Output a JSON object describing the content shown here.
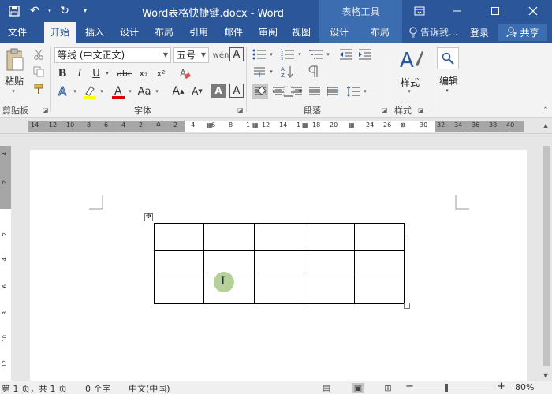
{
  "titlebar": {
    "title": "Word表格快捷键.docx - Word",
    "context_tools": "表格工具",
    "save_icon": "💾",
    "undo_icon": "↶",
    "redo_icon": "↻",
    "qat_more_icon": "⯆",
    "ribbon_options_icon": "▭",
    "minimize_icon": "—",
    "maximize_icon": "☐",
    "close_icon": "✕"
  },
  "tabs": [
    {
      "label": "文件"
    },
    {
      "label": "开始"
    },
    {
      "label": "插入"
    },
    {
      "label": "设计"
    },
    {
      "label": "布局"
    },
    {
      "label": "引用"
    },
    {
      "label": "邮件"
    },
    {
      "label": "审阅"
    },
    {
      "label": "视图"
    },
    {
      "label": "设计"
    },
    {
      "label": "布局"
    }
  ],
  "tell_me": "告诉我...",
  "login": "登录",
  "share": "共享",
  "ribbon": {
    "clipboard": {
      "label": "剪贴板",
      "paste_label": "粘贴"
    },
    "font": {
      "label": "字体",
      "font_name": "等线 (中文正文)",
      "font_size": "五号",
      "bold": "B",
      "italic": "I",
      "underline": "U",
      "strike": "abc",
      "subscript": "x₂",
      "superscript": "x²",
      "text_effects": "A",
      "highlight": "ab",
      "font_color": "A",
      "change_case": "Aa",
      "grow": "A",
      "shrink": "A",
      "clear_format": "A",
      "char_border": "A",
      "char_shade": "A",
      "phonetic": "wén",
      "enclose": "A"
    },
    "paragraph": {
      "label": "段落"
    },
    "styles": {
      "label": "样式",
      "button_label": "样式"
    },
    "editing": {
      "button_label": "编辑"
    }
  },
  "ruler": {
    "left_numbers": [
      "14",
      "12",
      "10",
      "8",
      "6",
      "4",
      "2"
    ],
    "mid_numbers": [
      "2",
      "4",
      "6",
      "8",
      "1",
      "12",
      "14",
      "1",
      "18",
      "20",
      "24",
      "26"
    ],
    "right_numbers": [
      "30",
      "32",
      "34",
      "36",
      "38",
      "40"
    ]
  },
  "vruler": {
    "numbers": [
      "4",
      "2",
      "2",
      "4",
      "6",
      "8",
      "10",
      "12"
    ]
  },
  "statusbar": {
    "pages": "第 1 页，共 1 页",
    "words": "0 个字",
    "language": "中文(中国)",
    "zoom": "80%",
    "zoom_minus": "−",
    "zoom_plus": "+"
  },
  "table": {
    "rows": 3,
    "cols": 5
  }
}
